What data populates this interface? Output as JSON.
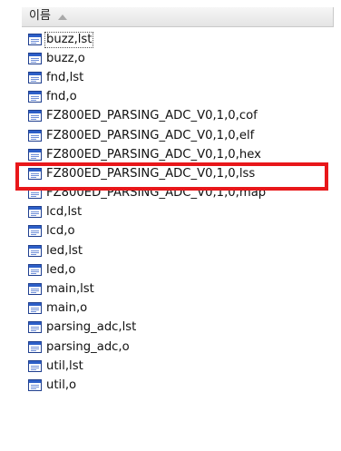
{
  "header": {
    "column_label": "이름",
    "sort_direction": "ascending",
    "sort_icon": "sort-ascending-icon"
  },
  "files": [
    {
      "name": "buzz,lst"
    },
    {
      "name": "buzz,o"
    },
    {
      "name": "fnd,lst"
    },
    {
      "name": "fnd,o"
    },
    {
      "name": "FZ800ED_PARSING_ADC_V0,1,0,cof"
    },
    {
      "name": "FZ800ED_PARSING_ADC_V0,1,0,elf"
    },
    {
      "name": "FZ800ED_PARSING_ADC_V0,1,0,hex"
    },
    {
      "name": "FZ800ED_PARSING_ADC_V0,1,0,lss"
    },
    {
      "name": "FZ800ED_PARSING_ADC_V0,1,0,map"
    },
    {
      "name": "lcd,lst"
    },
    {
      "name": "lcd,o"
    },
    {
      "name": "led,lst"
    },
    {
      "name": "led,o"
    },
    {
      "name": "main,lst"
    },
    {
      "name": "main,o"
    },
    {
      "name": "parsing_adc,lst"
    },
    {
      "name": "parsing_adc,o"
    },
    {
      "name": "util,lst"
    },
    {
      "name": "util,o"
    }
  ],
  "highlight_color": "#e8171a",
  "icon_colors": {
    "frame": "#1f3f8f",
    "title_bar": "#2d5fc8",
    "body": "#ffffff",
    "line": "#6f8fd8"
  }
}
